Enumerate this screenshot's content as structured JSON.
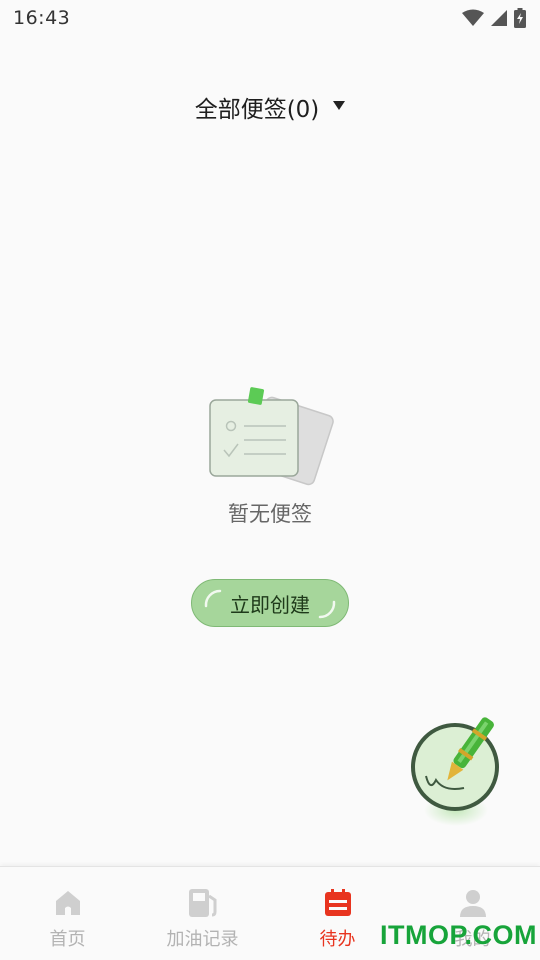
{
  "status_bar": {
    "time": "16:43",
    "icons": [
      "wifi-icon",
      "cellular-signal-icon",
      "battery-charging-icon"
    ]
  },
  "header": {
    "filter_label": "全部便签(0)",
    "dropdown_icon": "caret-down-icon"
  },
  "empty_state": {
    "illustration": "sticky-note-icon",
    "message": "暂无便签",
    "create_button_label": "立即创建"
  },
  "fab": {
    "icon": "pen-icon"
  },
  "bottom_nav": {
    "items": [
      {
        "label": "首页",
        "icon": "home-icon",
        "active": false
      },
      {
        "label": "加油记录",
        "icon": "fuel-pump-icon",
        "active": false
      },
      {
        "label": "待办",
        "icon": "calendar-icon",
        "active": true
      },
      {
        "label": "我的",
        "icon": "user-icon",
        "active": false
      }
    ]
  },
  "watermark": {
    "text": "ITMOP.COM"
  },
  "colors": {
    "accent_active": "#e8341f",
    "button_green": "#a6d69b",
    "inactive_icon": "#cfcfcf",
    "watermark_green": "#17a43a"
  }
}
